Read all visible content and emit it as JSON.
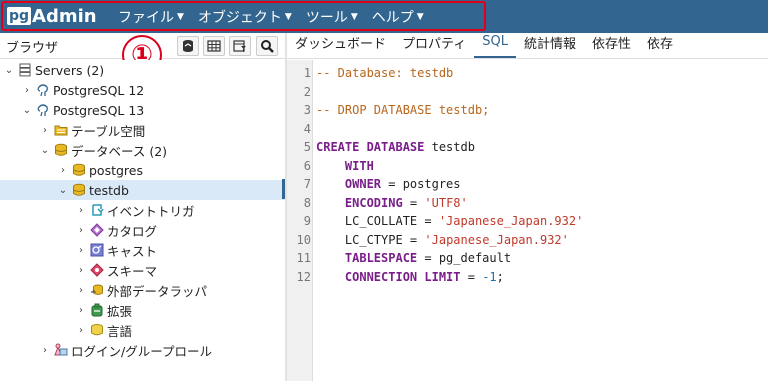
{
  "app": {
    "logo_pg": "pg",
    "logo_admin": "Admin"
  },
  "menu": [
    {
      "label": "ファイル"
    },
    {
      "label": "オブジェクト"
    },
    {
      "label": "ツール"
    },
    {
      "label": "ヘルプ"
    }
  ],
  "callout": {
    "number": "①"
  },
  "browser": {
    "title": "ブラウザ"
  },
  "tabs": [
    {
      "label": "ダッシュボード"
    },
    {
      "label": "プロパティ"
    },
    {
      "label": "SQL"
    },
    {
      "label": "統計情報"
    },
    {
      "label": "依存性"
    },
    {
      "label": "依存"
    }
  ],
  "tree": [
    {
      "label": "Servers (2)",
      "expanded": true,
      "icon": "servers-icon"
    },
    {
      "label": "PostgreSQL 12",
      "expanded": false,
      "icon": "elephant-icon"
    },
    {
      "label": "PostgreSQL 13",
      "expanded": true,
      "icon": "elephant-icon"
    },
    {
      "label": "テーブル空間",
      "expanded": false,
      "icon": "folder-icon"
    },
    {
      "label": "データベース (2)",
      "expanded": true,
      "icon": "database-icon"
    },
    {
      "label": "postgres",
      "expanded": false,
      "icon": "database-icon"
    },
    {
      "label": "testdb",
      "expanded": true,
      "icon": "database-icon",
      "selected": true
    },
    {
      "label": "イベントトリガ",
      "expanded": false,
      "icon": "event-trigger-icon"
    },
    {
      "label": "カタログ",
      "expanded": false,
      "icon": "catalog-icon"
    },
    {
      "label": "キャスト",
      "expanded": false,
      "icon": "cast-icon"
    },
    {
      "label": "スキーマ",
      "expanded": false,
      "icon": "schema-icon"
    },
    {
      "label": "外部データラッパ",
      "expanded": false,
      "icon": "fdw-icon"
    },
    {
      "label": "拡張",
      "expanded": false,
      "icon": "extension-icon"
    },
    {
      "label": "言語",
      "expanded": false,
      "icon": "language-icon"
    },
    {
      "label": "ログイン/グループロール",
      "expanded": false,
      "icon": "login-role-icon"
    }
  ],
  "sql": {
    "line_numbers": [
      "1",
      "2",
      "3",
      "4",
      "5",
      "6",
      "7",
      "8",
      "9",
      "10",
      "11",
      "12"
    ],
    "line1": "-- Database: testdb",
    "line3": "-- DROP DATABASE testdb;",
    "line5_kw": "CREATE DATABASE",
    "line5_rest": " testdb",
    "line6_kw": "WITH",
    "line7_kw": "OWNER",
    "line7_rest": " = postgres",
    "line8_kw": "ENCODING",
    "line8_eq": " = ",
    "line8_str": "'UTF8'",
    "line9_pre": "LC_COLLATE = ",
    "line9_str": "'Japanese_Japan.932'",
    "line10_pre": "LC_CTYPE = ",
    "line10_str": "'Japanese_Japan.932'",
    "line11_kw": "TABLESPACE",
    "line11_rest": " = pg_default",
    "line12_kw": "CONNECTION LIMIT",
    "line12_eq": " = ",
    "line12_num": "-1",
    "line12_end": ";"
  },
  "colors": {
    "navbar": "#326690",
    "highlight": "#e0001a",
    "selected_row": "#d9e9f7"
  }
}
